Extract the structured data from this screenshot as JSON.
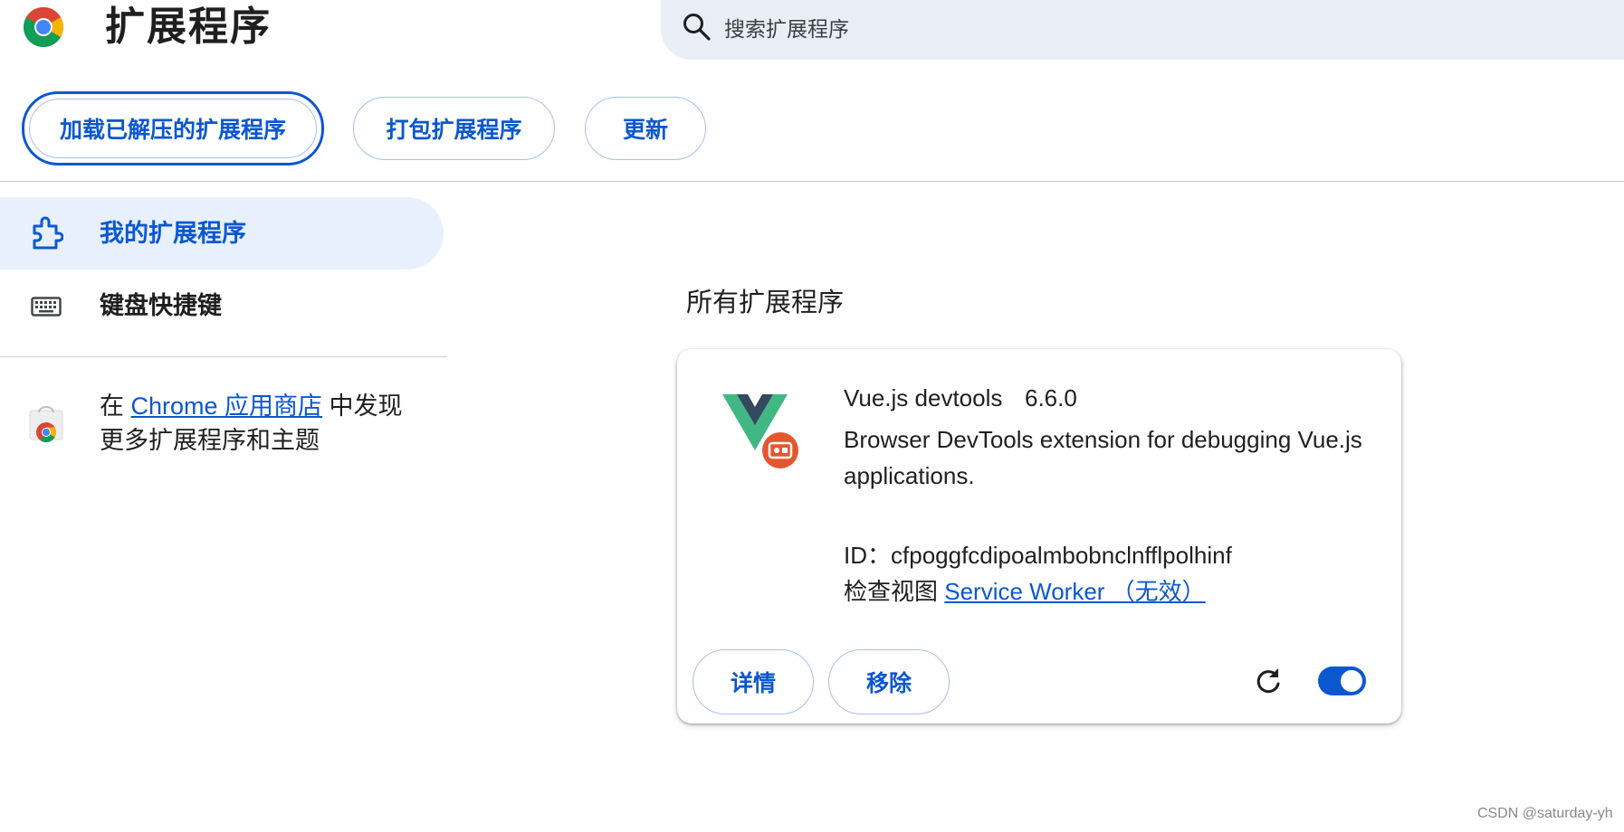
{
  "header": {
    "title": "扩展程序",
    "search_placeholder": "搜索扩展程序"
  },
  "toolbar": {
    "load_unpacked_label": "加载已解压的扩展程序",
    "pack_extension_label": "打包扩展程序",
    "update_label": "更新"
  },
  "sidebar": {
    "items": [
      {
        "label": "我的扩展程序",
        "icon": "puzzle-icon",
        "selected": true
      },
      {
        "label": "键盘快捷键",
        "icon": "keyboard-icon",
        "selected": false
      }
    ],
    "webstore": {
      "prefix": "在 ",
      "link": "Chrome 应用商店",
      "suffix": " 中发现更多扩展程序和主题"
    }
  },
  "main": {
    "section_heading": "所有扩展程序",
    "extension": {
      "name": "Vue.js devtools",
      "version": "6.6.0",
      "description": "Browser DevTools extension for debugging Vue.js applications.",
      "id_label": "ID：",
      "id_value": "cfpoggfcdipoalmbobnclnfflpolhinf",
      "inspect_label": "检查视图 ",
      "inspect_link": "Service Worker （无效）",
      "details_label": "详情",
      "remove_label": "移除",
      "enabled": true
    }
  },
  "watermark": "CSDN @saturday-yh",
  "colors": {
    "accent": "#0b57d0",
    "selected_bg": "#e8f0fe",
    "search_bg": "#e9eef6"
  }
}
